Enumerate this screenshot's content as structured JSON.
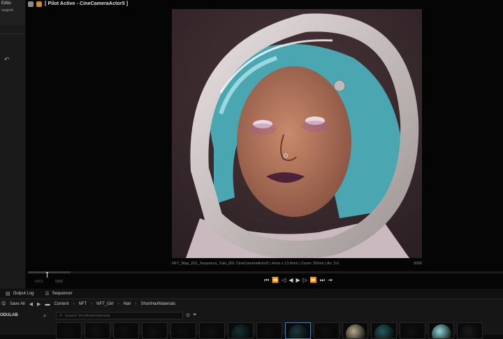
{
  "left_panel": {
    "line1": "Edito",
    "line2": "ecpport",
    "undo_icon": "undo-icon"
  },
  "viewport": {
    "title": "[ Pilot Active - CineCameraActor5 ]",
    "caption": "NFT_Map_001_Sequence_Yuki_001 CineCameraActor5 | 4mm x 13.4mm | Zoom: 50mm | Av: 3.6",
    "caption_right": "0000",
    "icons": [
      "camera-icon",
      "pilot-icon"
    ]
  },
  "timeline": {
    "frame_start": "-0001",
    "frame_end": "0000",
    "progress": 0.09
  },
  "transport": {
    "buttons": [
      {
        "name": "jump-to-start-icon",
        "glyph": "⏮"
      },
      {
        "name": "step-back-key-icon",
        "glyph": "⏪"
      },
      {
        "name": "step-back-frame-icon",
        "glyph": "◁"
      },
      {
        "name": "play-reverse-icon",
        "glyph": "◀"
      },
      {
        "name": "play-icon",
        "glyph": "▶"
      },
      {
        "name": "step-forward-frame-icon",
        "glyph": "▷"
      },
      {
        "name": "step-forward-key-icon",
        "glyph": "⏩"
      },
      {
        "name": "jump-to-end-icon",
        "glyph": "⏭"
      },
      {
        "name": "loop-icon",
        "glyph": "⇥"
      }
    ]
  },
  "bottom": {
    "tabs": [
      {
        "label": "Output Log",
        "icon": "output-log-icon"
      },
      {
        "label": "Sequencer",
        "icon": "sequencer-icon"
      }
    ],
    "save_all": "Save All",
    "breadcrumbs": [
      "Content",
      "NFT",
      "NFT_Girl",
      "Hair",
      "ShortHairMaterials"
    ],
    "left_label": "ODULAB",
    "search_placeholder": "Search ShortHairMaterials",
    "asset_thumbnails": [
      "#0f0f0f",
      "#111",
      "#0f0f0f",
      "#111",
      "#0f0f0f",
      "#111",
      "#123233",
      "#0f0f0f",
      "#1b3a3e",
      "#0f0f0f",
      "#b5a98a",
      "#245b5c",
      "#111",
      "#8fd6d8",
      "#1a1a1a"
    ]
  },
  "colors": {
    "accent_blue": "#4a7fb0",
    "timeline_green": "#3e8f3e"
  }
}
